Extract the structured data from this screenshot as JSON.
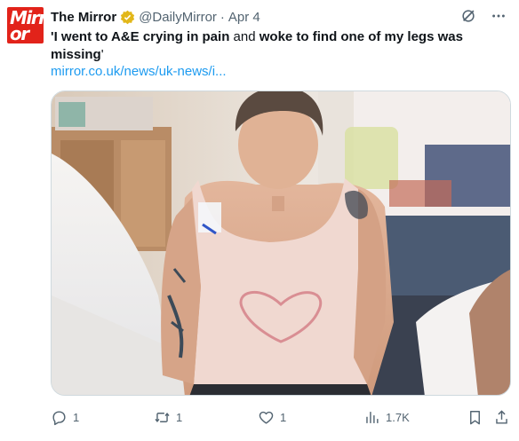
{
  "account": {
    "avatar_logo_line1": "Mirr",
    "avatar_logo_line2": "or",
    "display_name": "The Mirror",
    "handle": "@DailyMirror",
    "separator": "·",
    "timestamp": "Apr 4",
    "verified_badge_color": "#e2b719"
  },
  "tweet": {
    "text_part1": "'I went to A&E crying in pain",
    "text_part2": " and ",
    "text_part3": "woke to find one of my legs was missing",
    "text_part4": "'",
    "link": "mirror.co.uk/news/uk-news/i..."
  },
  "top_actions": {
    "grok_icon": "grok-icon",
    "more_icon": "more-icon"
  },
  "actions": {
    "reply_count": "1",
    "retweet_count": "1",
    "like_count": "1",
    "views_count": "1.7K"
  },
  "colors": {
    "brand_red": "#e2231a",
    "link_blue": "#1d9bf0",
    "muted_gray": "#536471"
  }
}
